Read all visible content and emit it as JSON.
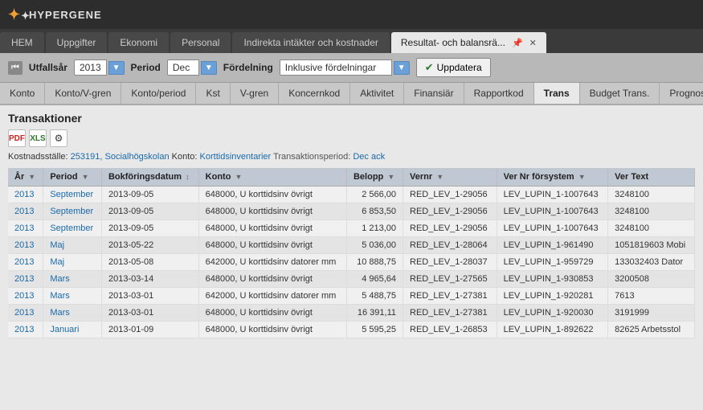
{
  "app": {
    "name": "HYPERGENE"
  },
  "tabs": [
    {
      "id": "hem",
      "label": "HEM",
      "active": false
    },
    {
      "id": "uppgifter",
      "label": "Uppgifter",
      "active": false
    },
    {
      "id": "ekonomi",
      "label": "Ekonomi",
      "active": false
    },
    {
      "id": "personal",
      "label": "Personal",
      "active": false
    },
    {
      "id": "indirekta",
      "label": "Indirekta intäkter och kostnader",
      "active": false
    },
    {
      "id": "resultat",
      "label": "Resultat- och balansrä...",
      "active": true
    }
  ],
  "toolbar": {
    "utfallsar_label": "Utfallsår",
    "utfallsar_value": "2013",
    "period_label": "Period",
    "period_value": "Dec",
    "fordelning_label": "Fördelning",
    "fordelning_value": "Inklusive fördelningar",
    "update_label": "Uppdatera"
  },
  "col_tabs": [
    {
      "id": "konto",
      "label": "Konto",
      "active": false
    },
    {
      "id": "konto-vgren",
      "label": "Konto/V-gren",
      "active": false
    },
    {
      "id": "konto-period",
      "label": "Konto/period",
      "active": false
    },
    {
      "id": "kst",
      "label": "Kst",
      "active": false
    },
    {
      "id": "v-gren",
      "label": "V-gren",
      "active": false
    },
    {
      "id": "koncernkod",
      "label": "Koncernkod",
      "active": false
    },
    {
      "id": "aktivitet",
      "label": "Aktivitet",
      "active": false
    },
    {
      "id": "finansiar",
      "label": "Finansiär",
      "active": false
    },
    {
      "id": "rapportkod",
      "label": "Rapportkod",
      "active": false
    },
    {
      "id": "trans",
      "label": "Trans",
      "active": true
    },
    {
      "id": "budget-trans",
      "label": "Budget Trans.",
      "active": false
    },
    {
      "id": "prognos-trans",
      "label": "Prognos Trans",
      "active": false
    }
  ],
  "section": {
    "title": "Transaktioner",
    "kostnadsställe_label": "Kostnadsställe:",
    "kostnadsställe_value": "253191, Socialhögskolan",
    "konto_label": "Konto:",
    "konto_value": "Korttidsinventarier",
    "transaktionsperiod_label": "Transaktionsperiod:",
    "transaktionsperiod_value": "Dec ack"
  },
  "table": {
    "headers": [
      {
        "id": "ar",
        "label": "År"
      },
      {
        "id": "period",
        "label": "Period"
      },
      {
        "id": "bokforingsdatum",
        "label": "Bokföringsdatum"
      },
      {
        "id": "konto",
        "label": "Konto"
      },
      {
        "id": "belopp",
        "label": "Belopp"
      },
      {
        "id": "vernr",
        "label": "Vernr"
      },
      {
        "id": "ver-nr-forsystem",
        "label": "Ver Nr försystem"
      },
      {
        "id": "ver-text",
        "label": "Ver Text"
      }
    ],
    "rows": [
      {
        "ar": "2013",
        "period": "September",
        "bokforingsdatum": "2013-09-05",
        "konto": "648000, U korttidsinv övrigt",
        "belopp": "2 566,00",
        "vernr": "RED_LEV_1-29056",
        "ver_nr_forsystem": "LEV_LUPIN_1-1007643",
        "ver_text": "3248100"
      },
      {
        "ar": "2013",
        "period": "September",
        "bokforingsdatum": "2013-09-05",
        "konto": "648000, U korttidsinv övrigt",
        "belopp": "6 853,50",
        "vernr": "RED_LEV_1-29056",
        "ver_nr_forsystem": "LEV_LUPIN_1-1007643",
        "ver_text": "3248100"
      },
      {
        "ar": "2013",
        "period": "September",
        "bokforingsdatum": "2013-09-05",
        "konto": "648000, U korttidsinv övrigt",
        "belopp": "1 213,00",
        "vernr": "RED_LEV_1-29056",
        "ver_nr_forsystem": "LEV_LUPIN_1-1007643",
        "ver_text": "3248100"
      },
      {
        "ar": "2013",
        "period": "Maj",
        "bokforingsdatum": "2013-05-22",
        "konto": "648000, U korttidsinv övrigt",
        "belopp": "5 036,00",
        "vernr": "RED_LEV_1-28064",
        "ver_nr_forsystem": "LEV_LUPIN_1-961490",
        "ver_text": "1051819603 Mobi"
      },
      {
        "ar": "2013",
        "period": "Maj",
        "bokforingsdatum": "2013-05-08",
        "konto": "642000, U korttidsinv datorer mm",
        "belopp": "10 888,75",
        "vernr": "RED_LEV_1-28037",
        "ver_nr_forsystem": "LEV_LUPIN_1-959729",
        "ver_text": "133032403 Dator"
      },
      {
        "ar": "2013",
        "period": "Mars",
        "bokforingsdatum": "2013-03-14",
        "konto": "648000, U korttidsinv övrigt",
        "belopp": "4 965,64",
        "vernr": "RED_LEV_1-27565",
        "ver_nr_forsystem": "LEV_LUPIN_1-930853",
        "ver_text": "3200508"
      },
      {
        "ar": "2013",
        "period": "Mars",
        "bokforingsdatum": "2013-03-01",
        "konto": "642000, U korttidsinv datorer mm",
        "belopp": "5 488,75",
        "vernr": "RED_LEV_1-27381",
        "ver_nr_forsystem": "LEV_LUPIN_1-920281",
        "ver_text": "7613"
      },
      {
        "ar": "2013",
        "period": "Mars",
        "bokforingsdatum": "2013-03-01",
        "konto": "648000, U korttidsinv övrigt",
        "belopp": "16 391,11",
        "vernr": "RED_LEV_1-27381",
        "ver_nr_forsystem": "LEV_LUPIN_1-920030",
        "ver_text": "3191999"
      },
      {
        "ar": "2013",
        "period": "Januari",
        "bokforingsdatum": "2013-01-09",
        "konto": "648000, U korttidsinv övrigt",
        "belopp": "5 595,25",
        "vernr": "RED_LEV_1-26853",
        "ver_nr_forsystem": "LEV_LUPIN_1-892622",
        "ver_text": "82625 Arbetsstol"
      }
    ]
  }
}
